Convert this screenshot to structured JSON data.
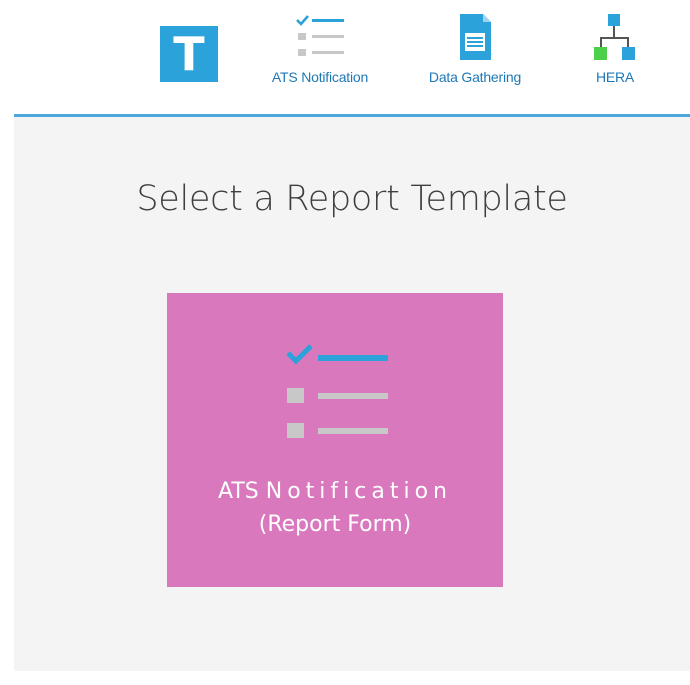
{
  "nav": {
    "logo_letter": "T",
    "items": [
      {
        "label": "ATS Notification",
        "icon": "checklist-icon"
      },
      {
        "label": "Data Gathering",
        "icon": "document-icon"
      },
      {
        "label": "HERA",
        "icon": "hierarchy-icon"
      }
    ]
  },
  "main": {
    "title": "Select a Report Template",
    "tiles": [
      {
        "line1_prefix": "ATS",
        "line1_spaced": "Notification",
        "line2": "(Report Form)",
        "icon": "checklist-icon"
      }
    ]
  },
  "colors": {
    "accent": "#2ba2d9",
    "divider": "#4aa8dc",
    "tile_background": "#da78bd",
    "content_background": "#f4f4f4",
    "nav_label": "#1e78b7",
    "hera_green": "#4cd04a"
  }
}
